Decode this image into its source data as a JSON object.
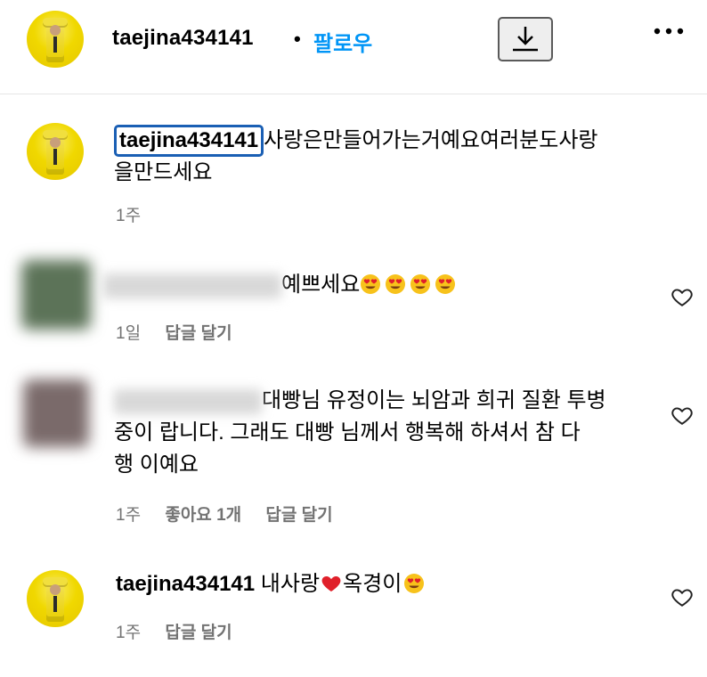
{
  "header": {
    "username": "taejina434141",
    "separator": "•",
    "follow_label": "팔로우"
  },
  "comments": [
    {
      "author": "taejina434141",
      "text_line1": "사랑은만들어가는거예요여러분도사랑",
      "text_line2": "을만드세요",
      "time": "1주"
    },
    {
      "author": "",
      "text": "예쁘세요",
      "emoji": "heart-eyes-emoji x4",
      "time": "1일",
      "reply_label": "답글 달기"
    },
    {
      "author": "",
      "text_line1": "대빵님 유정이는 뇌암과 희귀 질환 투병",
      "text_line2": "중이 랍니다. 그래도 대빵 님께서 행복해 하셔서 참 다",
      "text_line3": "행 이예요",
      "time": "1주",
      "likes": "좋아요 1개",
      "reply_label": "답글 달기"
    },
    {
      "author": "taejina434141",
      "text_a": "내사랑",
      "text_b": "옥경이",
      "time": "1주",
      "reply_label": "답글 달기"
    }
  ],
  "colors": {
    "link_blue": "#0095f6",
    "meta_gray": "#737373",
    "highlight": "#1a5fb4"
  }
}
